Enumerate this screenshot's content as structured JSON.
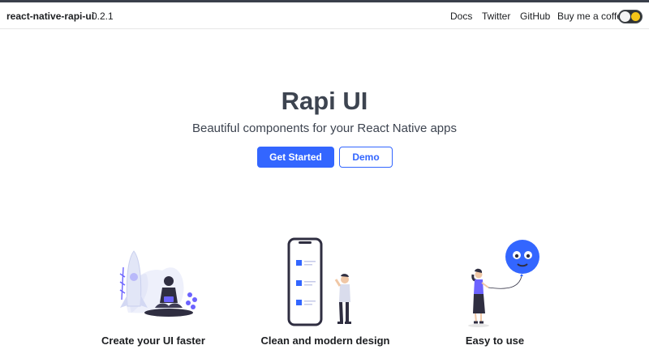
{
  "navbar": {
    "brand": "react-native-rapi-ui",
    "version": "0.2.1",
    "links": [
      {
        "label": "Docs"
      },
      {
        "label": "Twitter"
      },
      {
        "label": "GitHub"
      },
      {
        "label": "Buy me a coffee"
      }
    ],
    "theme_toggle": {
      "state": "light",
      "icon": "sun-icon"
    }
  },
  "hero": {
    "title": "Rapi UI",
    "subtitle": "Beautiful components for your React Native apps",
    "primary_button": "Get Started",
    "secondary_button": "Demo"
  },
  "features": [
    {
      "title": "Create your UI faster",
      "illustration": "rocket-developer-illustration"
    },
    {
      "title": "Clean and modern design",
      "illustration": "phone-ui-illustration"
    },
    {
      "title": "Easy to use",
      "illustration": "balloon-girl-illustration"
    }
  ],
  "colors": {
    "accent": "#3366ff",
    "heading": "#3d4450",
    "illustration_primary": "#6c63ff",
    "illustration_dark": "#2f2e41",
    "toggle_bg": "#2f3336",
    "sun": "#f5c518"
  }
}
